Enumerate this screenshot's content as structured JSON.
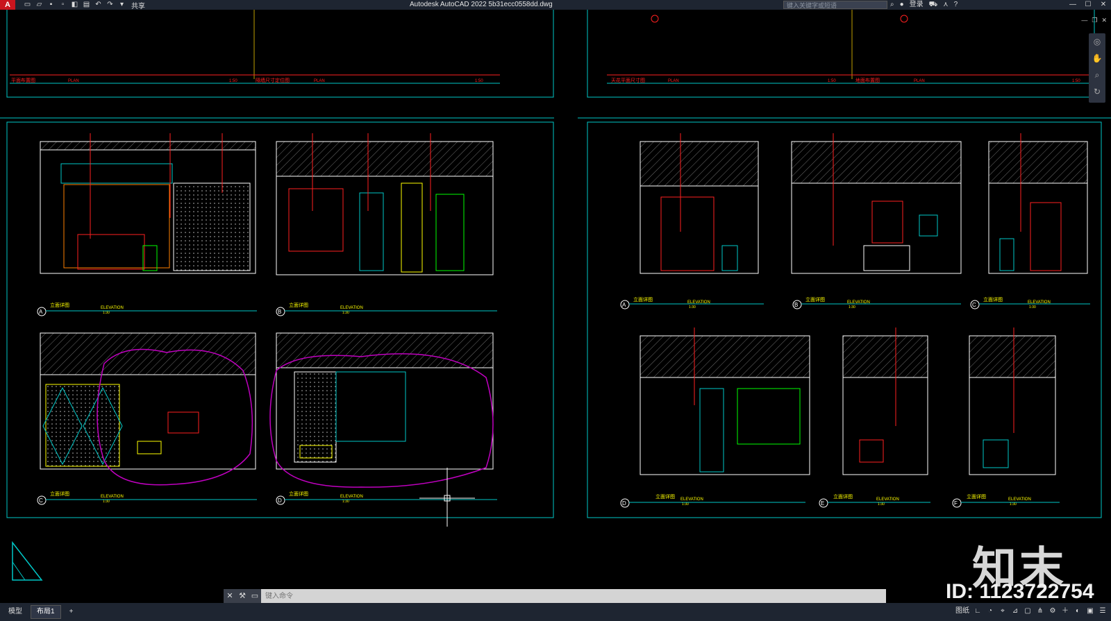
{
  "titlebar": {
    "logo": "A",
    "share": "共享",
    "app_title": "Autodesk AutoCAD 2022    5b31ecc0558dd.dwg",
    "search_placeholder": "键入关键字或短语",
    "login": "登录",
    "help": "?"
  },
  "window_controls": {
    "minimize": "—",
    "maximize": "☐",
    "close": "✕"
  },
  "drawing": {
    "plan_labels": [
      "平面布置图",
      "隔墙尺寸定位图",
      "天花平面尺寸图",
      "地面布置图"
    ],
    "plan_sub": "PLAN",
    "plan_scale": "1:50",
    "elevations_left": [
      {
        "mark": "A",
        "title": "立面详图",
        "sub": "ELEVATION",
        "scale": "1:30"
      },
      {
        "mark": "B",
        "title": "立面详图",
        "sub": "ELEVATION",
        "scale": "1:30"
      },
      {
        "mark": "C",
        "title": "立面详图",
        "sub": "ELEVATION",
        "scale": "1:30"
      },
      {
        "mark": "D",
        "title": "立面详图",
        "sub": "ELEVATION",
        "scale": "1:30"
      }
    ],
    "elevations_right": [
      {
        "mark": "A",
        "title": "立面详图",
        "sub": "ELEVATION",
        "scale": "1:30"
      },
      {
        "mark": "B",
        "title": "立面详图",
        "sub": "ELEVATION",
        "scale": "1:30"
      },
      {
        "mark": "C",
        "title": "立面详图",
        "sub": "ELEVATION",
        "scale": "1:30"
      },
      {
        "mark": "D",
        "title": "立面详图",
        "sub": "ELEVATION",
        "scale": "1:30"
      },
      {
        "mark": "E",
        "title": "立面详图",
        "sub": "ELEVATION",
        "scale": "1:30"
      },
      {
        "mark": "F",
        "title": "立面详图",
        "sub": "ELEVATION",
        "scale": "1:30"
      }
    ]
  },
  "command": {
    "placeholder": "键入命令"
  },
  "status": {
    "tabs": [
      "模型",
      "布局1",
      "+"
    ],
    "active_tab": "布局1",
    "paper": "图纸"
  },
  "watermark": {
    "logo": "知末",
    "id": "ID: 1123722754"
  },
  "colors": {
    "accent": "#c9151e",
    "frame": "#00c8c8",
    "annotation": "#ffff00",
    "leader": "#ff2020",
    "cloud": "#c000c0",
    "line": "#00ff00"
  }
}
